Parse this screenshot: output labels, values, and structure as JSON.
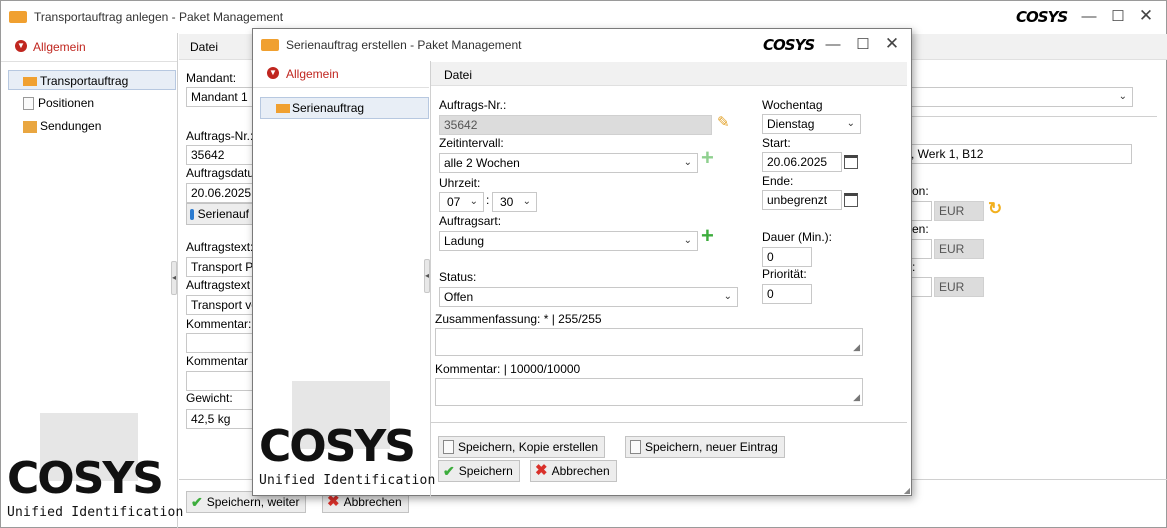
{
  "main": {
    "title": "Transportauftrag anlegen - Paket Management",
    "brand": "COSYS",
    "section": "Allgemein",
    "nav": [
      "Transportauftrag",
      "Positionen",
      "Sendungen"
    ],
    "tab": "Datei",
    "mandant_label": "Mandant:",
    "mandant_value": "Mandant 1",
    "auftragsnr_label": "Auftrags-Nr.:",
    "auftragsnr_value": "35642",
    "auftragsdatum_label": "Auftragsdatu",
    "auftragsdatum_value": "20.06.2025",
    "serienauftrag_btn": "Serienauf",
    "auftragstext_label": "Auftragstext:",
    "auftragstext_value": "Transport Pr",
    "auftragstext2_label": "Auftragstext :",
    "auftragstext2_value": "Transport vo",
    "kommentar_label": "Kommentar:",
    "kommentar2_label": "Kommentar 2",
    "gewicht_label": "Gewicht:",
    "gewicht_value": "42,5 kg",
    "address_value": ", Werk 1, B12",
    "on_label": "on:",
    "en_label": "en:",
    "colon_label": ":",
    "currency": [
      "EUR",
      "EUR",
      "EUR"
    ],
    "save_next": "Speichern, weiter",
    "cancel": "Abbrechen",
    "logo_sub": "Unified Identification"
  },
  "dialog": {
    "title": "Serienauftrag erstellen - Paket Management",
    "brand": "COSYS",
    "section": "Allgemein",
    "nav_item": "Serienauftrag",
    "tab": "Datei",
    "auftragsnr_label": "Auftrags-Nr.:",
    "auftragsnr_value": "35642",
    "zeitintervall_label": "Zeitintervall:",
    "zeitintervall_value": "alle 2 Wochen",
    "uhrzeit_label": "Uhrzeit:",
    "hour": "07",
    "minute": "30",
    "auftragsart_label": "Auftragsart:",
    "auftragsart_value": "Ladung",
    "status_label": "Status:",
    "status_value": "Offen",
    "wochentag_label": "Wochentag",
    "wochentag_value": "Dienstag",
    "start_label": "Start:",
    "start_value": "20.06.2025",
    "ende_label": "Ende:",
    "ende_value": "unbegrenzt",
    "dauer_label": "Dauer (Min.):",
    "dauer_value": "0",
    "prioritaet_label": "Priorität:",
    "prioritaet_value": "0",
    "zusammenfassung_label": "Zusammenfassung: * | 255/255",
    "kommentar_label": "Kommentar: | 10000/10000",
    "save_copy": "Speichern, Kopie erstellen",
    "save_new": "Speichern, neuer Eintrag",
    "save": "Speichern",
    "cancel": "Abbrechen",
    "logo_sub": "Unified Identification"
  }
}
